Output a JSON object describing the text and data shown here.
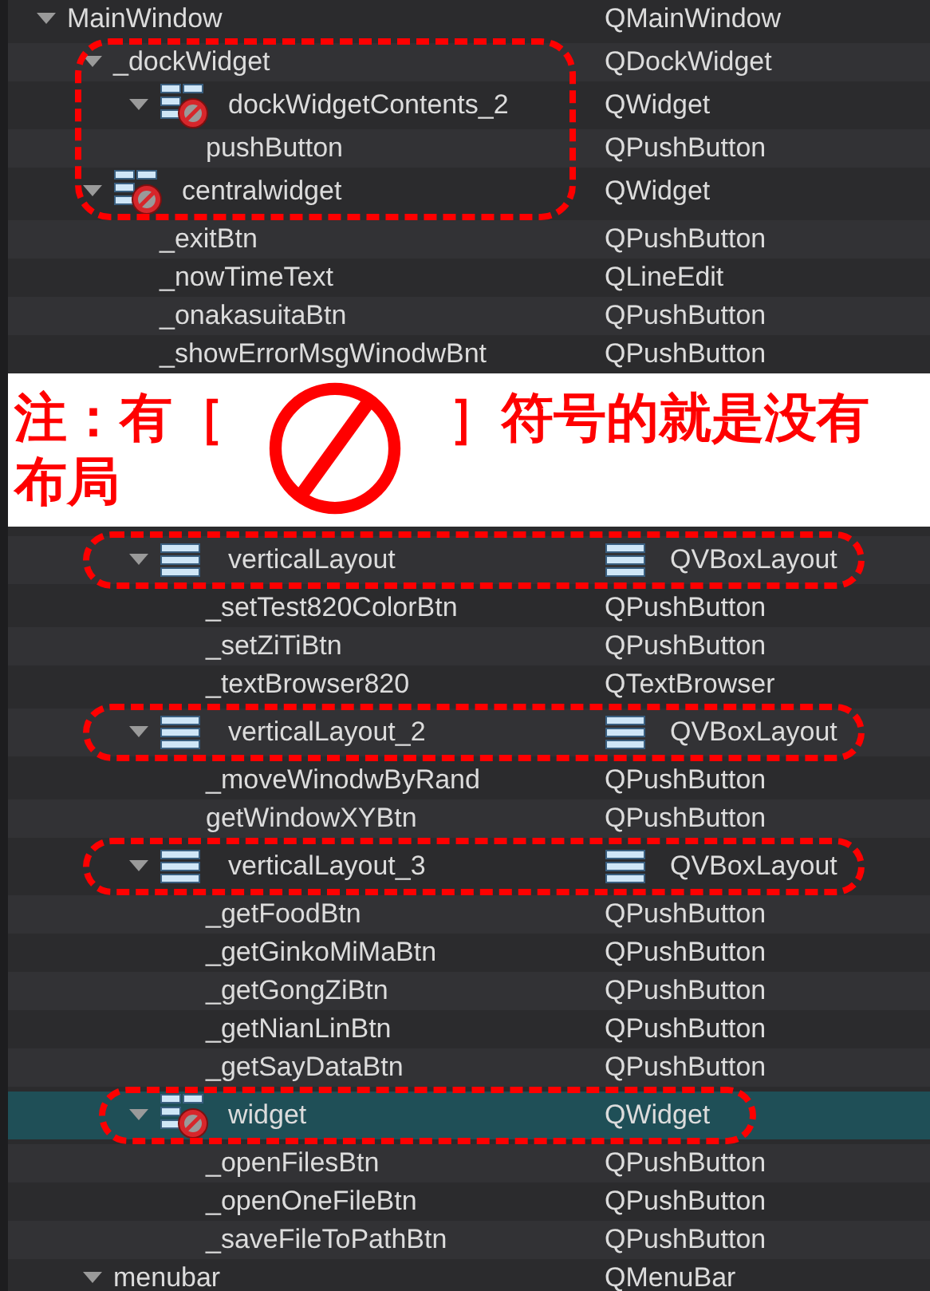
{
  "tree": [
    {
      "name": "MainWindow",
      "class": "QMainWindow",
      "kind": "plain",
      "selected": false,
      "expanded": true,
      "children": [
        {
          "name": "_dockWidget",
          "class": "QDockWidget",
          "kind": "plain",
          "selected": false,
          "expanded": true,
          "circled": true,
          "children": [
            {
              "name": "dockWidgetContents_2",
              "class": "QWidget",
              "kind": "widget",
              "selected": false,
              "expanded": true,
              "circled": true,
              "children": [
                {
                  "name": "pushButton",
                  "class": "QPushButton",
                  "kind": "plain",
                  "selected": false,
                  "circled": true
                }
              ]
            }
          ]
        },
        {
          "name": "centralwidget",
          "class": "QWidget",
          "kind": "widget",
          "selected": false,
          "expanded": true,
          "circled": true,
          "children": [
            {
              "name": "_exitBtn",
              "class": "QPushButton",
              "kind": "plain",
              "selected": false
            },
            {
              "name": "_nowTimeText",
              "class": "QLineEdit",
              "kind": "plain",
              "selected": false
            },
            {
              "name": "_onakasuitaBtn",
              "class": "QPushButton",
              "kind": "plain",
              "selected": false
            },
            {
              "name": "_showErrorMsgWinodwBnt",
              "class": "QPushButton",
              "kind": "plain",
              "selected": false,
              "note_below": true
            },
            {
              "name": "verticalLayout",
              "class": "QVBoxLayout",
              "kind": "layout",
              "selected": false,
              "expanded": true,
              "circled": true,
              "children": [
                {
                  "name": "_setTest820ColorBtn",
                  "class": "QPushButton",
                  "kind": "plain",
                  "selected": false
                },
                {
                  "name": "_setZiTiBtn",
                  "class": "QPushButton",
                  "kind": "plain",
                  "selected": false
                },
                {
                  "name": "_textBrowser820",
                  "class": "QTextBrowser",
                  "kind": "plain",
                  "selected": false
                }
              ]
            },
            {
              "name": "verticalLayout_2",
              "class": "QVBoxLayout",
              "kind": "layout",
              "selected": false,
              "expanded": true,
              "circled": true,
              "children": [
                {
                  "name": "_moveWinodwByRand",
                  "class": "QPushButton",
                  "kind": "plain",
                  "selected": false
                },
                {
                  "name": "getWindowXYBtn",
                  "class": "QPushButton",
                  "kind": "plain",
                  "selected": false
                }
              ]
            },
            {
              "name": "verticalLayout_3",
              "class": "QVBoxLayout",
              "kind": "layout",
              "selected": false,
              "expanded": true,
              "circled": true,
              "children": [
                {
                  "name": "_getFoodBtn",
                  "class": "QPushButton",
                  "kind": "plain",
                  "selected": false
                },
                {
                  "name": "_getGinkoMiMaBtn",
                  "class": "QPushButton",
                  "kind": "plain",
                  "selected": false
                },
                {
                  "name": "_getGongZiBtn",
                  "class": "QPushButton",
                  "kind": "plain",
                  "selected": false
                },
                {
                  "name": "_getNianLinBtn",
                  "class": "QPushButton",
                  "kind": "plain",
                  "selected": false
                },
                {
                  "name": "_getSayDataBtn",
                  "class": "QPushButton",
                  "kind": "plain",
                  "selected": false
                }
              ]
            },
            {
              "name": "widget",
              "class": "QWidget",
              "kind": "widget",
              "selected": true,
              "expanded": true,
              "circled": true,
              "children": [
                {
                  "name": "_openFilesBtn",
                  "class": "QPushButton",
                  "kind": "plain",
                  "selected": false
                },
                {
                  "name": "_openOneFileBtn",
                  "class": "QPushButton",
                  "kind": "plain",
                  "selected": false
                },
                {
                  "name": "_saveFileToPathBtn",
                  "class": "QPushButton",
                  "kind": "plain",
                  "selected": false
                }
              ]
            }
          ]
        },
        {
          "name": "menubar",
          "class": "QMenuBar",
          "kind": "plain",
          "selected": false,
          "expanded": true
        }
      ]
    }
  ],
  "note": {
    "before": "注：有［",
    "after": "］符号的就是没有",
    "continued": "布局"
  }
}
